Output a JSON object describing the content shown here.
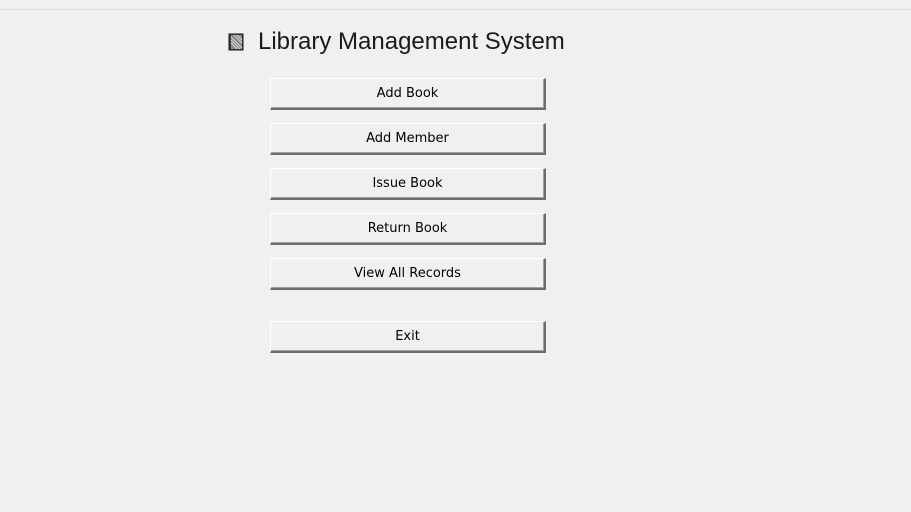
{
  "header": {
    "title": "Library Management System",
    "icon": "book-icon"
  },
  "menu": {
    "add_book_label": "Add Book",
    "add_member_label": "Add Member",
    "issue_book_label": "Issue Book",
    "return_book_label": "Return Book",
    "view_all_records_label": "View All Records",
    "exit_label": "Exit"
  },
  "colors": {
    "background": "#f0f0f0",
    "button_face": "#f0f0f0",
    "button_shadow": "#6d6d6d",
    "text": "#000000"
  }
}
